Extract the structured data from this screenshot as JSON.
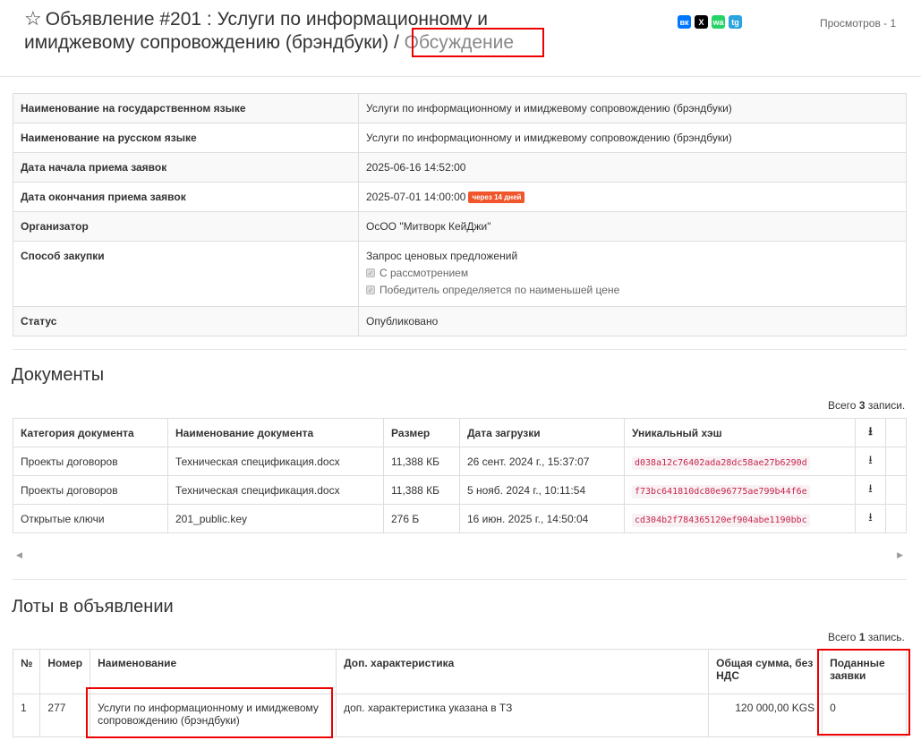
{
  "header": {
    "title_main": "Объявление #201 : Услуги по информационному и имиджевому сопровождению (брэндбуки) /",
    "title_link": "Обсуждение",
    "views": "Просмотров - 1",
    "share": [
      "вк",
      "X",
      "wa",
      "tg"
    ]
  },
  "info": {
    "rows": [
      {
        "key": "Наименование на государственном языке",
        "value": "Услуги по информационному и имиджевому сопровождению (брэндбуки)"
      },
      {
        "key": "Наименование на русском языке",
        "value": "Услуги по информационному и имиджевому сопровождению (брэндбуки)"
      },
      {
        "key": "Дата начала приема заявок",
        "value": "2025-06-16 14:52:00"
      },
      {
        "key": "Дата окончания приема заявок",
        "value": "2025-07-01 14:00:00",
        "badge": "через 14 дней"
      },
      {
        "key": "Организатор",
        "value": "ОсОО \"Митворк КейДжи\""
      },
      {
        "key": "Способ закупки",
        "value": "Запрос ценовых предложений",
        "checks": [
          "С рассмотрением",
          "Победитель определяется по наименьшей цене"
        ]
      },
      {
        "key": "Статус",
        "value": "Опубликовано"
      }
    ]
  },
  "documents": {
    "heading": "Документы",
    "count_prefix": "Всего ",
    "count": "3",
    "count_suffix": " записи.",
    "columns": [
      "Категория документа",
      "Наименование документа",
      "Размер",
      "Дата загрузки",
      "Уникальный хэш"
    ],
    "rows": [
      {
        "category": "Проекты договоров",
        "name": "Техническая спецификация.docx",
        "size": "11,388 КБ",
        "date": "26 сент. 2024 г., 15:37:07",
        "hash": "d038a12c76402ada28dc58ae27b6290d"
      },
      {
        "category": "Проекты договоров",
        "name": "Техническая спецификация.docx",
        "size": "11,388 КБ",
        "date": "5 нояб. 2024 г., 10:11:54",
        "hash": "f73bc641810dc80e96775ae799b44f6e"
      },
      {
        "category": "Открытые ключи",
        "name": "201_public.key",
        "size": "276 Б",
        "date": "16 июн. 2025 г., 14:50:04",
        "hash": "cd304b2f784365120ef904abe1190bbc"
      }
    ]
  },
  "lots": {
    "heading": "Лоты в объявлении",
    "count_prefix": "Всего ",
    "count": "1",
    "count_suffix": " запись.",
    "columns": [
      "№",
      "Номер",
      "Наименование",
      "Доп. характеристика",
      "Общая сумма, без НДС",
      "Поданные заявки"
    ],
    "rows": [
      {
        "n": "1",
        "number": "277",
        "name": "Услуги по информационному и имиджевому сопровождению (брэндбуки)",
        "extra": "доп. характеристика указана в ТЗ",
        "sum": "120 000,00 KGS",
        "bids": "0"
      }
    ]
  }
}
